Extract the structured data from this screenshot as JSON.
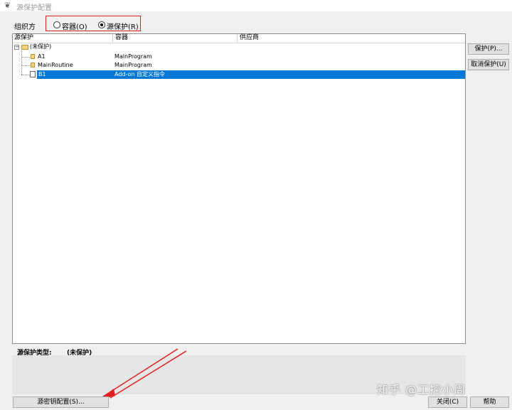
{
  "window": {
    "title": "源保护配置"
  },
  "org": {
    "label": "组织方",
    "options": [
      {
        "label": "容器(O)",
        "selected": false
      },
      {
        "label": "源保护(R)",
        "selected": true
      }
    ]
  },
  "table": {
    "columns": [
      "源保护",
      "容器",
      "供应商"
    ],
    "rows": [
      {
        "name": "(未保护)",
        "container": "",
        "supplier": ""
      },
      {
        "name": "A1",
        "container": "MainProgram",
        "supplier": ""
      },
      {
        "name": "MainRoutine",
        "container": "MainProgram",
        "supplier": ""
      },
      {
        "name": "B1",
        "container": "Add-on 自定义指令",
        "supplier": "",
        "selected": true
      }
    ]
  },
  "right_buttons": {
    "protect": "保护(P)...",
    "unprotect": "取消保护(U)"
  },
  "status": {
    "label": "源保护类型:",
    "value": "(未保护)"
  },
  "bottom": {
    "source_key_button": "源密钥配置(S)...",
    "close_button": "关闭(C)",
    "help_button": "帮助"
  },
  "watermark": "知乎 @工控小周",
  "colors": {
    "selection": "#0078d7",
    "highlight_box": "#e02020",
    "arrow": "#e02020"
  }
}
